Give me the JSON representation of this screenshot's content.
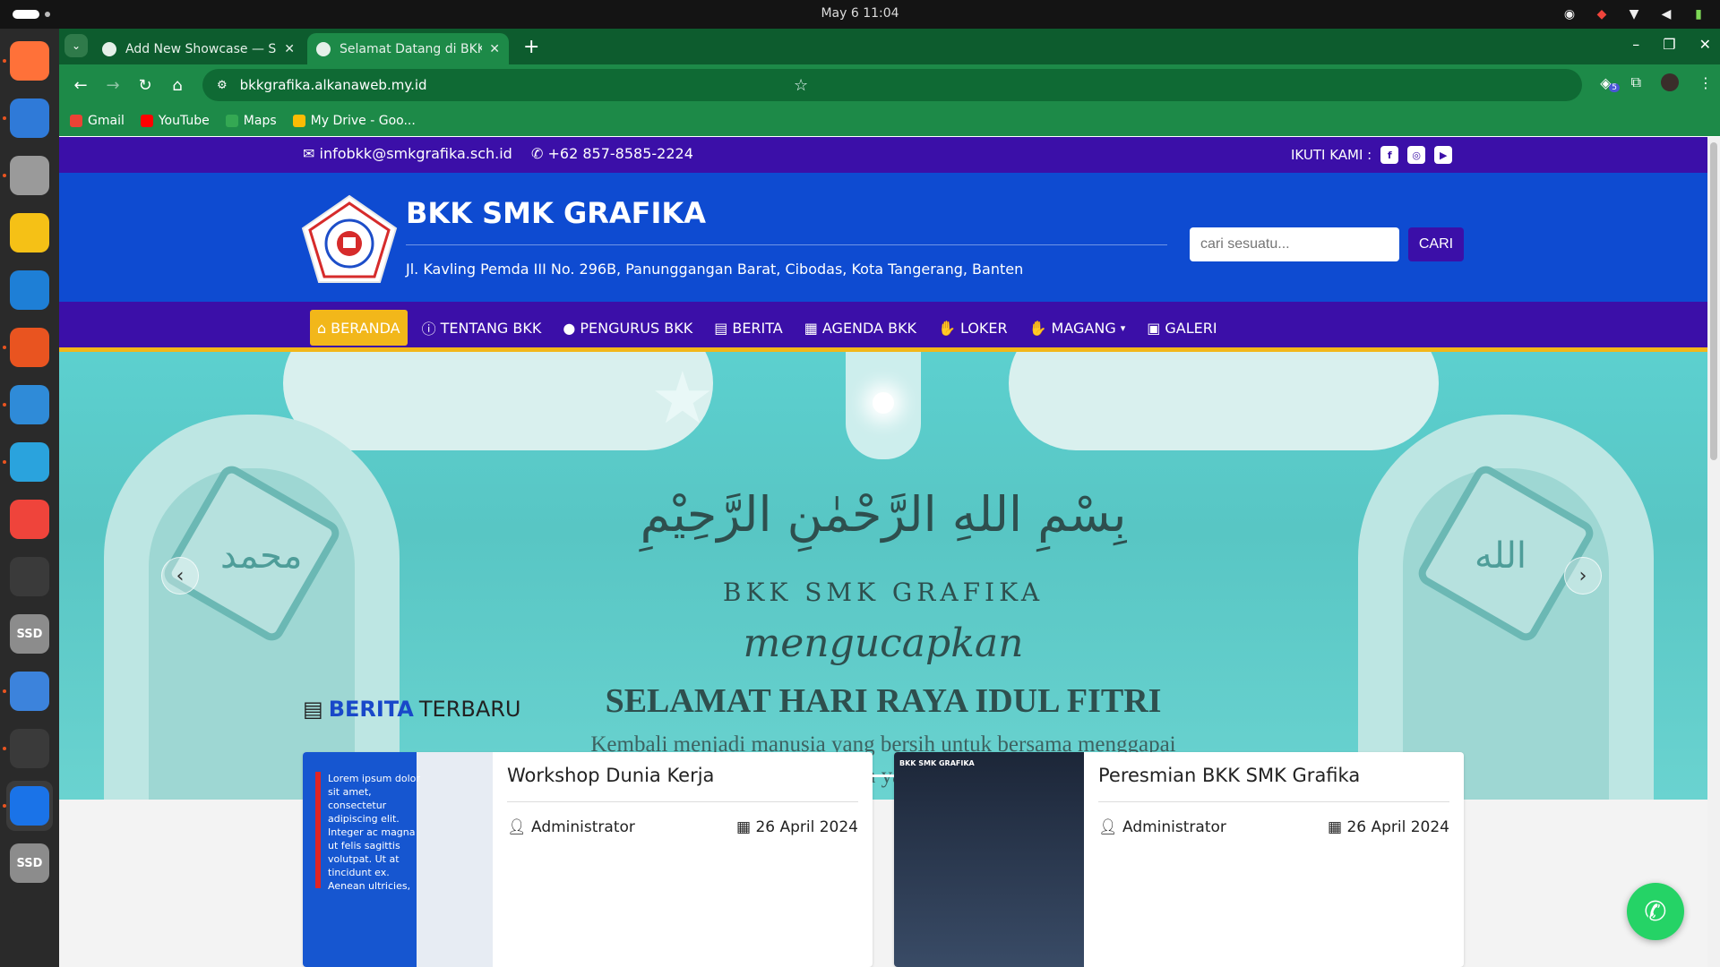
{
  "system": {
    "clock": "May 6  11:04"
  },
  "dock": {
    "apps": [
      {
        "name": "firefox-icon",
        "color": "#ff7139"
      },
      {
        "name": "thunderbird-icon",
        "color": "#2f7ad8"
      },
      {
        "name": "files-icon",
        "color": "#9a9a9a"
      },
      {
        "name": "rhythmbox-icon",
        "color": "#f5c116"
      },
      {
        "name": "writer-icon",
        "color": "#1e7fd6"
      },
      {
        "name": "app-center-icon",
        "color": "#e95420"
      },
      {
        "name": "help-icon",
        "color": "#2f8bd8"
      },
      {
        "name": "telegram-icon",
        "color": "#2aa3dd"
      },
      {
        "name": "anydesk-icon",
        "color": "#ef443b"
      },
      {
        "name": "terminal-icon",
        "color": "#3a3a3a"
      },
      {
        "name": "ssd-drive-icon",
        "color": "#8c8c8c"
      },
      {
        "name": "text-editor-icon",
        "color": "#3c83dc"
      },
      {
        "name": "system-monitor-icon",
        "color": "#3a3a3a"
      },
      {
        "name": "chrome-icon",
        "color": "#1a73e8"
      },
      {
        "name": "ssd-drive-icon-2",
        "color": "#8c8c8c"
      },
      {
        "name": "ubuntu-icon",
        "color": "#2a2a2a"
      }
    ],
    "ssd_label": "SSD"
  },
  "browser": {
    "tabs": [
      {
        "title": "Add New Showcase — Sa"
      },
      {
        "title": "Selamat Datang di BKK S"
      }
    ],
    "url": "bkkgrafika.alkanaweb.my.id",
    "bookmarks": [
      {
        "label": "Gmail",
        "color": "#ea4335"
      },
      {
        "label": "YouTube",
        "color": "#ff0000"
      },
      {
        "label": "Maps",
        "color": "#34a853"
      },
      {
        "label": "My Drive - Goo...",
        "color": "#fbbc04"
      }
    ],
    "extension_badge": "5"
  },
  "site": {
    "topbar": {
      "email": "infobkk@smkgrafika.sch.id",
      "phone": "+62 857-8585-2224",
      "follow_label": "IKUTI KAMI :"
    },
    "header": {
      "title": "BKK SMK GRAFIKA",
      "address": "Jl. Kavling Pemda III No. 296B, Panunggangan Barat, Cibodas, Kota Tangerang, Banten",
      "search_placeholder": "cari sesuatu...",
      "search_button": "CARI"
    },
    "nav": [
      {
        "label": "BERANDA",
        "icon": "home-icon",
        "glyph": "⌂"
      },
      {
        "label": "TENTANG BKK",
        "icon": "info-icon",
        "glyph": "ⓘ"
      },
      {
        "label": "PENGURUS BKK",
        "icon": "user-circle-icon",
        "glyph": "●"
      },
      {
        "label": "BERITA",
        "icon": "book-icon",
        "glyph": "▤"
      },
      {
        "label": "AGENDA BKK",
        "icon": "calendar-icon",
        "glyph": "▦"
      },
      {
        "label": "LOKER",
        "icon": "hand-icon",
        "glyph": "✋"
      },
      {
        "label": "MAGANG",
        "icon": "hand-icon-2",
        "glyph": "✋"
      },
      {
        "label": "GALERI",
        "icon": "images-icon",
        "glyph": "▣"
      }
    ],
    "hero": {
      "arabic": "بِسْمِ اللهِ الرَّحْمٰنِ الرَّحِيْمِ",
      "brand": "BKK SMK GRAFIKA",
      "greeting": "mengucapkan",
      "title": "SELAMAT HARI RAYA IDUL FITRI",
      "subtitle_1": "Kembali menjadi manusia yang bersih untuk bersama menggapai",
      "subtitle_2": "SMK Grafika yang gemilang",
      "left_calligraphy": "محمد",
      "right_calligraphy": "الله"
    },
    "news": {
      "heading_highlight": "BERITA",
      "heading_rest": "TERBARU",
      "items": [
        {
          "title": "Workshop Dunia Kerja",
          "author": "Administrator",
          "date": "26 April 2024",
          "thumb_text": "Lorem ipsum dolor sit amet, consectetur adipiscing elit. Integer ac magna ut felis sagittis volutpat. Ut at tincidunt ex. Aenean ultricies,"
        },
        {
          "title": "Peresmian BKK SMK Grafika",
          "author": "Administrator",
          "date": "26 April 2024",
          "thumb_text": "BKK SMK GRAFIKA"
        }
      ]
    }
  }
}
